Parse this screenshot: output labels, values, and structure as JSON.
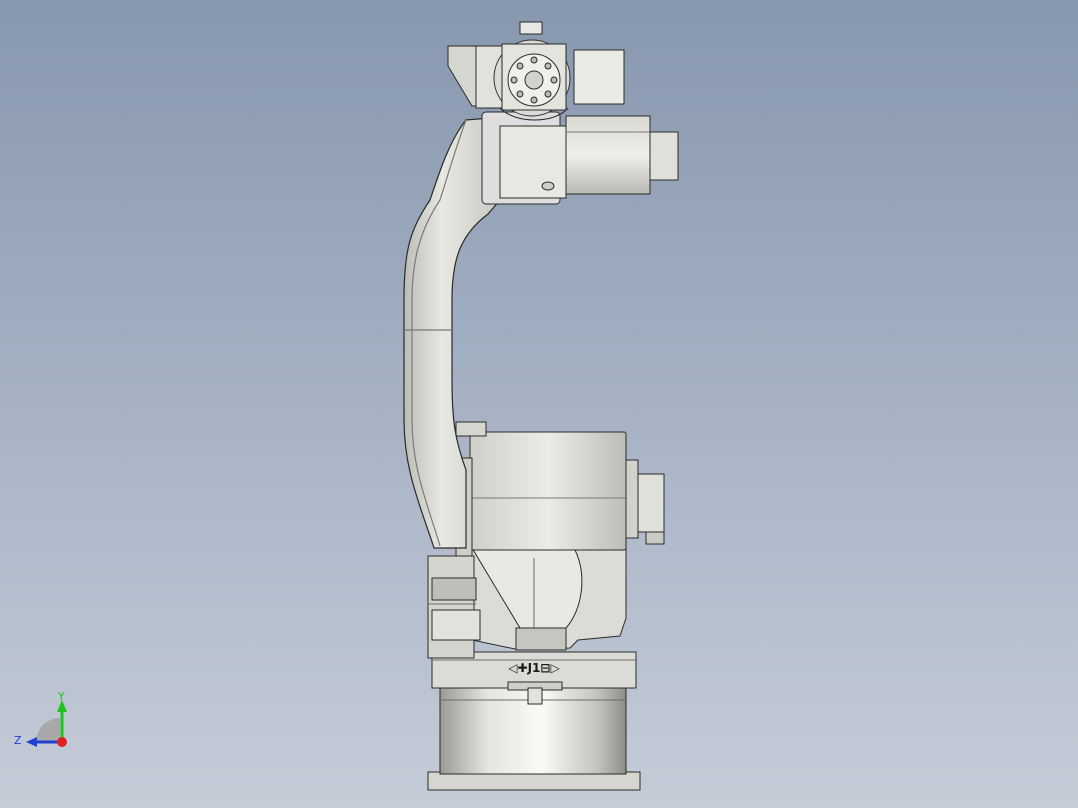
{
  "axis_triad": {
    "y_label": "Y",
    "z_label": "Z",
    "y_color": "#1fc21f",
    "z_color": "#1f3fd6",
    "x_color": "#e02020"
  },
  "joint_label": "◁✚J1⊟▷",
  "colors": {
    "body_light": "#e8e8e2",
    "body_mid": "#c9c9c3",
    "body_dark": "#8f8f8a",
    "outline": "#2a2a2a"
  }
}
